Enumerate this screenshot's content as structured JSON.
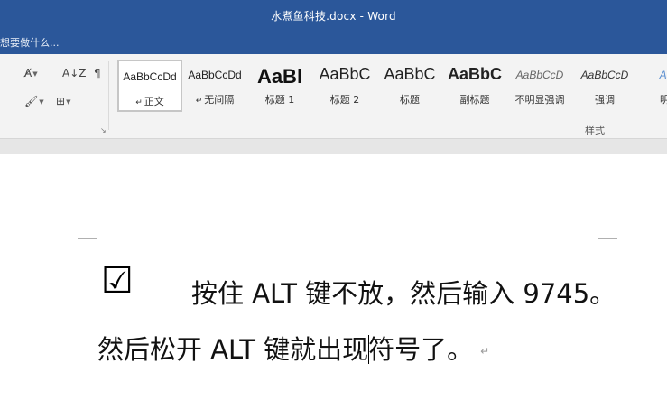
{
  "window": {
    "title": "水煮鱼科技.docx - Word"
  },
  "tell_me": {
    "placeholder": "想要做什么..."
  },
  "ribbon": {
    "tools": [
      {
        "id": "clear-format",
        "glyph": "A̸",
        "has_arrow": true
      },
      {
        "id": "sort",
        "glyph": "A↓Z",
        "has_arrow": false
      },
      {
        "id": "show-marks",
        "glyph": "¶",
        "has_arrow": false
      },
      {
        "id": "shading",
        "glyph": "🖌",
        "has_arrow": true
      },
      {
        "id": "borders",
        "glyph": "⊞",
        "has_arrow": true
      }
    ],
    "styles_group_label": "样式",
    "styles": [
      {
        "sample": "AaBbCcDd",
        "name": "正文",
        "para_mark": "↵",
        "selected": true,
        "sample_size": 12,
        "weight": "normal",
        "italic": false,
        "color": "#222222"
      },
      {
        "sample": "AaBbCcDd",
        "name": "无间隔",
        "para_mark": "↵",
        "selected": false,
        "sample_size": 12,
        "weight": "normal",
        "italic": false,
        "color": "#222222"
      },
      {
        "sample": "AaBl",
        "name": "标题 1",
        "para_mark": "",
        "selected": false,
        "sample_size": 22,
        "weight": "bold",
        "italic": false,
        "color": "#111111"
      },
      {
        "sample": "AaBbC",
        "name": "标题 2",
        "para_mark": "",
        "selected": false,
        "sample_size": 18,
        "weight": "normal",
        "italic": false,
        "color": "#222222"
      },
      {
        "sample": "AaBbC",
        "name": "标题",
        "para_mark": "",
        "selected": false,
        "sample_size": 18,
        "weight": "normal",
        "italic": false,
        "color": "#222222"
      },
      {
        "sample": "AaBbC",
        "name": "副标题",
        "para_mark": "",
        "selected": false,
        "sample_size": 18,
        "weight": "bold",
        "italic": false,
        "color": "#222222"
      },
      {
        "sample": "AaBbCcD",
        "name": "不明显强调",
        "para_mark": "",
        "selected": false,
        "sample_size": 12,
        "weight": "normal",
        "italic": true,
        "color": "#666666"
      },
      {
        "sample": "AaBbCcD",
        "name": "强调",
        "para_mark": "",
        "selected": false,
        "sample_size": 12,
        "weight": "normal",
        "italic": true,
        "color": "#333333"
      },
      {
        "sample": "AaB",
        "name": "明显",
        "para_mark": "",
        "selected": false,
        "sample_size": 12,
        "weight": "normal",
        "italic": true,
        "color": "#5b8fd0"
      }
    ]
  },
  "document": {
    "symbol": "☑",
    "line1": "按住 ALT 键不放，然后输入 9745。",
    "line2_before_cursor": "然后松开 ALT 键就出现",
    "line2_after_cursor": "符号了。",
    "paragraph_mark": "↵"
  },
  "colors": {
    "title_bar": "#2b579a",
    "ribbon_bg": "#f3f3f3",
    "canvas_bg": "#ffffff"
  }
}
